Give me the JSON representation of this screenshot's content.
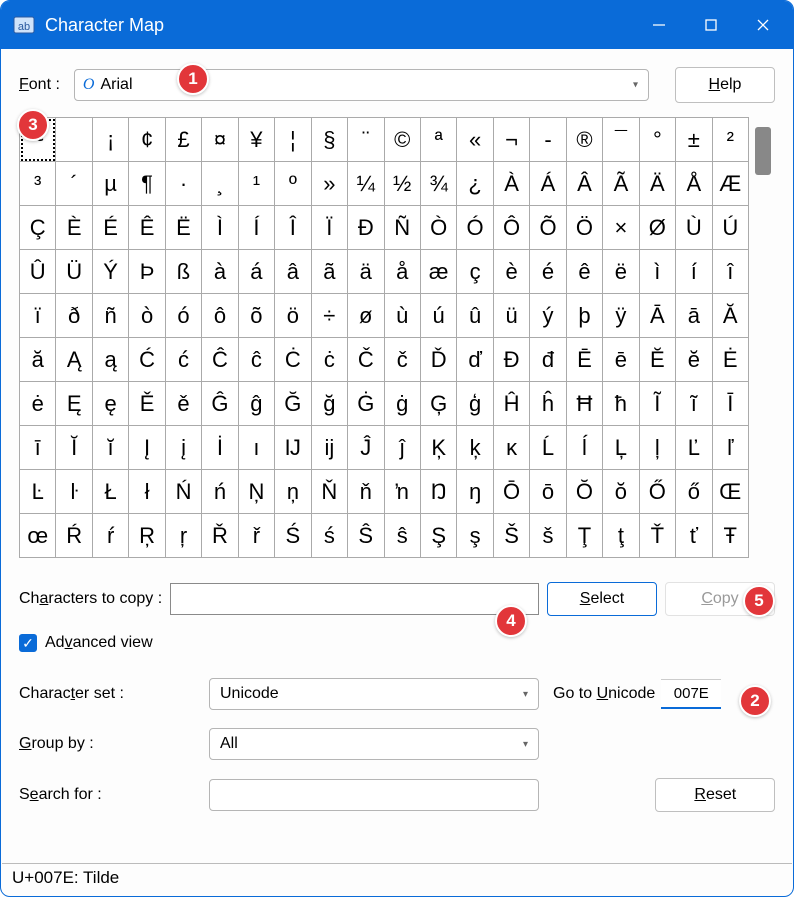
{
  "title": "Character Map",
  "font_label": "Font :",
  "font_value": "Arial",
  "help_label": "Help",
  "characters_to_copy_label": "Characters to copy :",
  "characters_to_copy_value": "",
  "select_label": "Select",
  "copy_label": "Copy",
  "advanced_view_label": "Advanced view",
  "advanced_view_checked": true,
  "character_set_label": "Character set :",
  "character_set_value": "Unicode",
  "go_to_unicode_label": "Go to Unicode",
  "go_to_unicode_value": "007E",
  "group_by_label": "Group by :",
  "group_by_value": "All",
  "search_for_label": "Search for :",
  "search_for_value": "",
  "reset_label": "Reset",
  "status_text": "U+007E: Tilde",
  "selected_index": 0,
  "callouts": [
    "1",
    "2",
    "3",
    "4",
    "5"
  ],
  "chars": [
    "~",
    " ",
    "¡",
    "¢",
    "£",
    "¤",
    "¥",
    "¦",
    "§",
    "¨",
    "©",
    "ª",
    "«",
    "¬",
    "-",
    "®",
    "¯",
    "°",
    "±",
    "²",
    "³",
    "´",
    "µ",
    "¶",
    "·",
    "¸",
    "¹",
    "º",
    "»",
    "¼",
    "½",
    "¾",
    "¿",
    "À",
    "Á",
    "Â",
    "Ã",
    "Ä",
    "Å",
    "Æ",
    "Ç",
    "È",
    "É",
    "Ê",
    "Ë",
    "Ì",
    "Í",
    "Î",
    "Ï",
    "Đ",
    "Ñ",
    "Ò",
    "Ó",
    "Ô",
    "Õ",
    "Ö",
    "×",
    "Ø",
    "Ù",
    "Ú",
    "Û",
    "Ü",
    "Ý",
    "Þ",
    "ß",
    "à",
    "á",
    "â",
    "ã",
    "ä",
    "å",
    "æ",
    "ç",
    "è",
    "é",
    "ê",
    "ë",
    "ì",
    "í",
    "î",
    "ï",
    "ð",
    "ñ",
    "ò",
    "ó",
    "ô",
    "õ",
    "ö",
    "÷",
    "ø",
    "ù",
    "ú",
    "û",
    "ü",
    "ý",
    "þ",
    "ÿ",
    "Ā",
    "ā",
    "Ă",
    "ă",
    "Ą",
    "ą",
    "Ć",
    "ć",
    "Ĉ",
    "ĉ",
    "Ċ",
    "ċ",
    "Č",
    "č",
    "Ď",
    "ď",
    "Đ",
    "đ",
    "Ē",
    "ē",
    "Ĕ",
    "ĕ",
    "Ė",
    "ė",
    "Ę",
    "ę",
    "Ě",
    "ě",
    "Ĝ",
    "ĝ",
    "Ğ",
    "ğ",
    "Ġ",
    "ġ",
    "Ģ",
    "ģ",
    "Ĥ",
    "ĥ",
    "Ħ",
    "ħ",
    "Ĩ",
    "ĩ",
    "Ī",
    "ī",
    "Ĭ",
    "ĭ",
    "Į",
    "į",
    "İ",
    "ı",
    "Ĳ",
    "ĳ",
    "Ĵ",
    "ĵ",
    "Ķ",
    "ķ",
    "ĸ",
    "Ĺ",
    "ĺ",
    "Ļ",
    "ļ",
    "Ľ",
    "ľ",
    "Ŀ",
    "ŀ",
    "Ł",
    "ł",
    "Ń",
    "ń",
    "Ņ",
    "ņ",
    "Ň",
    "ň",
    "ŉ",
    "Ŋ",
    "ŋ",
    "Ō",
    "ō",
    "Ŏ",
    "ŏ",
    "Ő",
    "ő",
    "Œ",
    "œ",
    "Ŕ",
    "ŕ",
    "Ŗ",
    "ŗ",
    "Ř",
    "ř",
    "Ś",
    "ś",
    "Ŝ",
    "ŝ",
    "Ş",
    "ş",
    "Š",
    "š",
    "Ţ",
    "ţ",
    "Ť",
    "ť",
    "Ŧ"
  ]
}
